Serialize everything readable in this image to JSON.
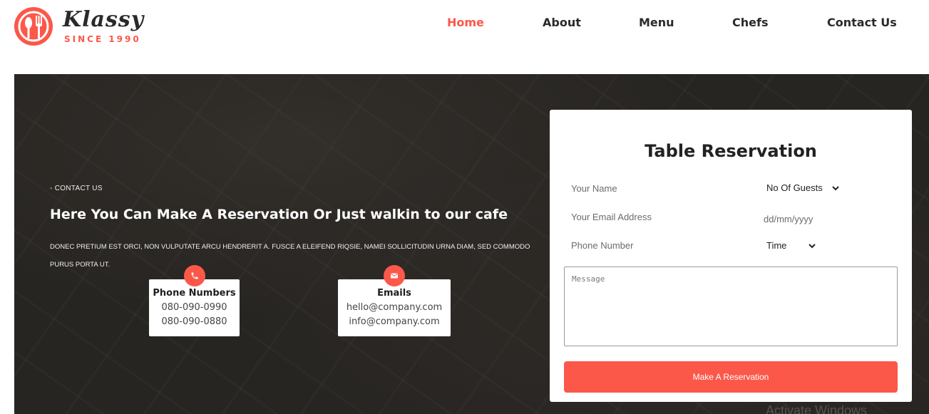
{
  "brand": {
    "name": "Klassy",
    "since": "SINCE 1990",
    "accent": "#fb5849"
  },
  "nav": {
    "items": [
      {
        "label": "Home",
        "active": true
      },
      {
        "label": "About"
      },
      {
        "label": "Menu"
      },
      {
        "label": "Chefs"
      },
      {
        "label": "Contact Us"
      }
    ]
  },
  "hero": {
    "kicker": "- CONTACT US",
    "headline": "Here You Can Make A Reservation Or Just walkin to our cafe",
    "description": "DONEC PRETIUM EST ORCI, NON VULPUTATE ARCU HENDRERIT A. FUSCE A ELEIFEND RIQSIE, NAMEI SOLLICITUDIN URNA DIAM, SED COMMODO PURUS PORTA UT.",
    "phone": {
      "title": "Phone Numbers",
      "lines": [
        "080-090-0990",
        "080-090-0880"
      ],
      "icon": "phone-icon"
    },
    "email": {
      "title": "Emails",
      "lines": [
        "hello@company.com",
        "info@company.com"
      ],
      "icon": "envelope-icon"
    }
  },
  "form": {
    "title": "Table Reservation",
    "name_placeholder": "Your Name",
    "email_placeholder": "Your Email Address",
    "phone_placeholder": "Phone Number",
    "guests_label": "No Of Guests",
    "date_placeholder": "dd/mm/yyyy",
    "time_label": "Time",
    "message_placeholder": "Message",
    "submit_label": "Make A Reservation"
  },
  "system": {
    "watermark": "Activate Windows"
  }
}
